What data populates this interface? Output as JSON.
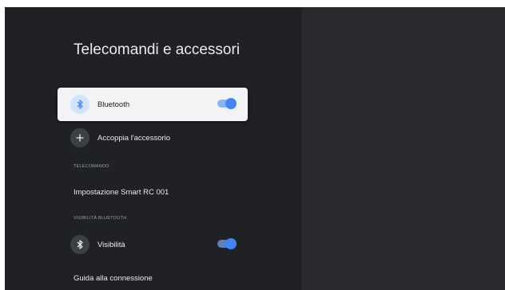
{
  "page": {
    "title": "Telecomandi e accessori"
  },
  "items": {
    "bluetooth": {
      "label": "Bluetooth",
      "icon": "bluetooth-icon",
      "toggle_on": true
    },
    "pair": {
      "label": "Accoppia l'accessorio",
      "icon": "plus-icon"
    },
    "remote_header": "TELECOMANDO",
    "remote_setup": {
      "label": "Impostazione Smart RC 001"
    },
    "visibility_header": "VISIBILITÀ BLUETOOTH",
    "visibility": {
      "label": "Visibilità",
      "icon": "bluetooth-icon",
      "toggle_on": true
    },
    "guide": {
      "label": "Guida alla connessione"
    }
  },
  "colors": {
    "accent": "#4285f4",
    "toggle_track": "#8ab4f8",
    "panel_bg": "#202125",
    "screen_bg": "#282a2e",
    "focused_bg": "#f1f3f4"
  }
}
